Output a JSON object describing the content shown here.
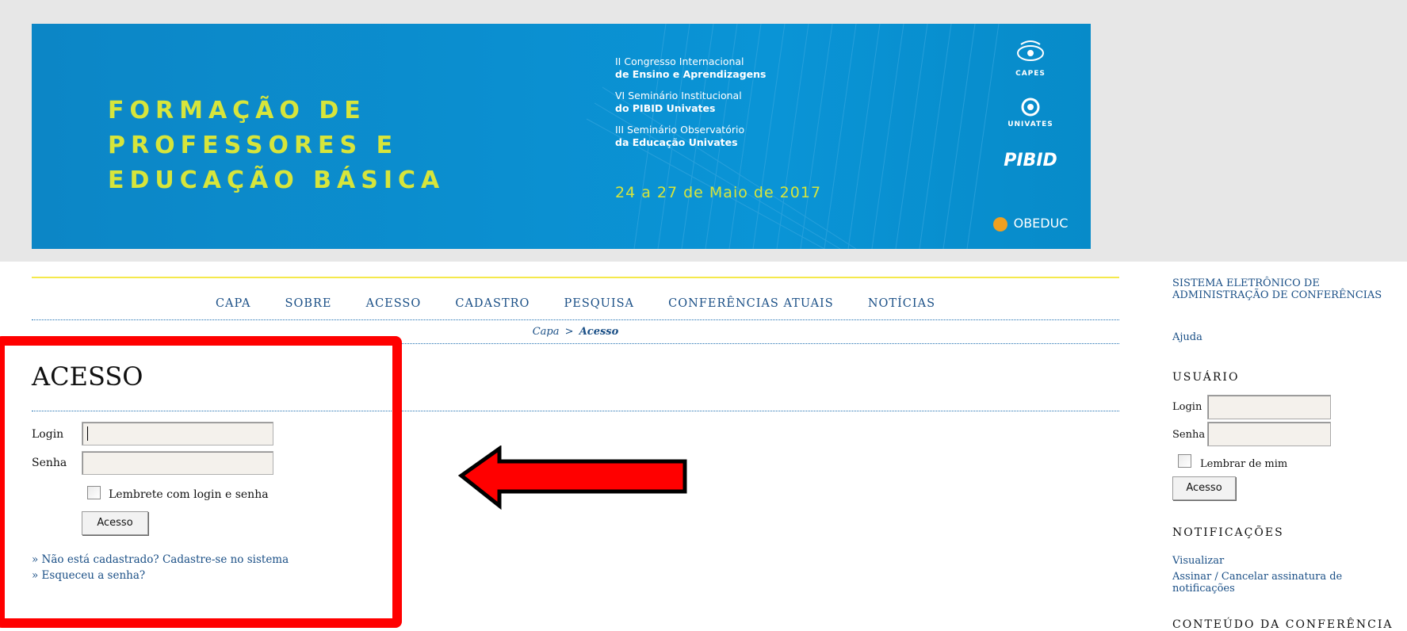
{
  "banner": {
    "title_lines": [
      "FORMAÇÃO DE",
      "PROFESSORES E",
      "EDUCAÇÃO BÁSICA"
    ],
    "events": [
      {
        "line1": "II Congresso Internacional",
        "line2": "de Ensino e Aprendizagens"
      },
      {
        "line1": "VI Seminário Institucional",
        "line2": "do PIBID Univates"
      },
      {
        "line1": "III Seminário Observatório",
        "line2": "da Educação Univates"
      }
    ],
    "date": "24 a 27 de Maio de 2017",
    "logos": {
      "capes": "CAPES",
      "univates": "UNIVATES",
      "pibid": "PIBID",
      "obeduc": "OBEDUC"
    }
  },
  "nav": {
    "items": [
      "CAPA",
      "SOBRE",
      "ACESSO",
      "CADASTRO",
      "PESQUISA",
      "CONFERÊNCIAS ATUAIS",
      "NOTÍCIAS"
    ]
  },
  "breadcrumb": {
    "home": "Capa",
    "separator": ">",
    "current": "Acesso"
  },
  "page": {
    "title": "ACESSO",
    "login_label": "Login",
    "password_label": "Senha",
    "remember_label": "Lembrete com login e senha",
    "submit_label": "Acesso",
    "register_link": "» Não está cadastrado? Cadastre-se no sistema",
    "forgot_link": "» Esqueceu a senha?"
  },
  "sidebar": {
    "system_title_line1": "SISTEMA ELETRÔNICO DE",
    "system_title_line2": "ADMINISTRAÇÃO DE CONFERÊNCIAS",
    "help_link": "Ajuda",
    "user_heading": "USUÁRIO",
    "login_label": "Login",
    "password_label": "Senha",
    "remember_label": "Lembrar de mim",
    "submit_label": "Acesso",
    "notifications_heading": "NOTIFICAÇÕES",
    "view_link": "Visualizar",
    "subscribe_link": "Assinar / Cancelar assinatura de notificações",
    "content_heading": "CONTEÚDO DA CONFERÊNCIA"
  },
  "colors": {
    "banner_blue": "#0b8fd0",
    "banner_title": "#d7e53b",
    "link": "#1a4f86",
    "highlight_red": "#ff0000"
  }
}
